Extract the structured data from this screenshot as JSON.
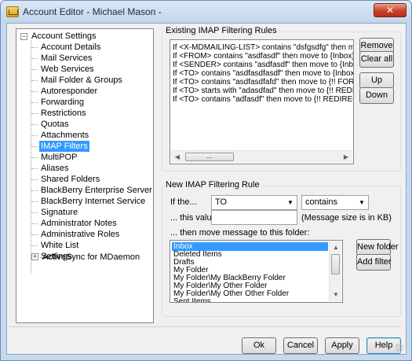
{
  "window": {
    "title": "Account Editor - Michael Mason -",
    "close_glyph": "✕"
  },
  "tree": {
    "root_label": "Account Settings",
    "items": [
      "Account Details",
      "Mail Services",
      "Web Services",
      "Mail Folder & Groups",
      "Autoresponder",
      "Forwarding",
      "Restrictions",
      "Quotas",
      "Attachments",
      "IMAP Filters",
      "MultiPOP",
      "Aliases",
      "Shared Folders",
      "BlackBerry Enterprise Server",
      "BlackBerry Internet Service",
      "Signature",
      "Administrator Notes",
      "Administrative Roles",
      "White List",
      "Settings"
    ],
    "selected": "IMAP Filters",
    "activesync_label": "ActiveSync for MDaemon",
    "expander_minus": "−",
    "expander_plus": "+"
  },
  "existing_rules": {
    "group_label": "Existing IMAP Filtering Rules",
    "rules": [
      "If <X-MDMAILING-LIST> contains \"dsfgsdfg\" then move to {In",
      "If <FROM> contains \"asdfasdf\" then move to {Inbox}",
      "If <SENDER> contains \"asdfasdf\" then move to {Inbox}",
      "If <TO> contains \"asdfasdfasdf\" then move to {Inbox}",
      "If <TO> contains \"asdfasdfafd\" then move to {!! FORWARD M",
      "If <TO> starts with \"adasdfad\" then move to {!! REDIRECT ME",
      "If <TO> contains \"adfasdf\" then move to {!! REDIRECT MESS"
    ],
    "remove_label": "Remove",
    "clear_all_label": "Clear all",
    "up_label": "Up",
    "down_label": "Down",
    "scroll_ellipsis": "..."
  },
  "new_rule": {
    "group_label": "New IMAP Filtering Rule",
    "if_the_label": "If the...",
    "header_value": "TO",
    "operator_value": "contains",
    "this_value_label": "... this value:",
    "this_value_input": "",
    "size_note": "(Message size is in KB)",
    "move_label": "... then move message to this folder:",
    "folders": [
      "Inbox",
      "Deleted Items",
      "Drafts",
      "My Folder",
      "My Folder\\My BlackBerry Folder",
      "My Folder\\My Other Folder",
      "My Folder\\My Other Other Folder",
      "Sent Items"
    ],
    "selected_folder": "Inbox",
    "new_folder_label": "New folder",
    "add_filter_label": "Add filter"
  },
  "footer": {
    "ok_label": "Ok",
    "cancel_label": "Cancel",
    "apply_label": "Apply",
    "help_label": "Help"
  },
  "icons": {
    "dropdown_arrow": "▼",
    "scroll_up": "▲",
    "scroll_down": "▼",
    "scroll_left": "◀",
    "scroll_right": "▶"
  }
}
